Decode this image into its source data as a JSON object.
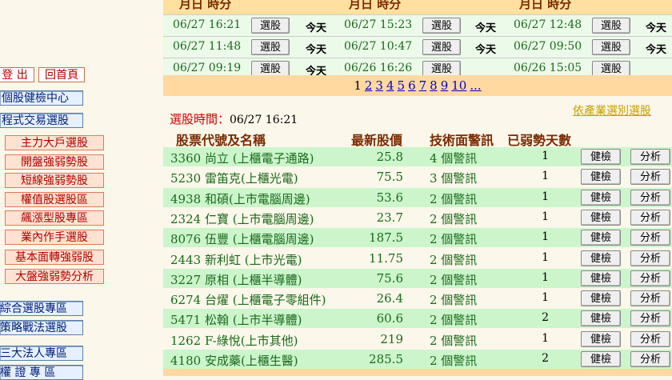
{
  "sidebar": {
    "logout": "登 出",
    "home": "回首頁",
    "items": [
      {
        "label": "個股健檢中心",
        "style": "blue"
      },
      {
        "label": "程式交易選股",
        "style": "blue"
      },
      {
        "label": "主力大戶選股",
        "style": "red"
      },
      {
        "label": "開盤強弱勢股",
        "style": "red"
      },
      {
        "label": "短線強弱勢股",
        "style": "red"
      },
      {
        "label": "權值股選股區",
        "style": "red"
      },
      {
        "label": "飆漲型股專區",
        "style": "red"
      },
      {
        "label": "業內作手選股",
        "style": "red"
      },
      {
        "label": "基本面轉強弱股",
        "style": "red"
      },
      {
        "label": "大盤強弱勢分析",
        "style": "red"
      },
      {
        "label": "綜合選股專區",
        "style": "blue"
      },
      {
        "label": "策略戰法選股",
        "style": "blue"
      },
      {
        "label": "三大法人專區",
        "style": "blue"
      },
      {
        "label": "權 證 專 區",
        "style": "blue"
      }
    ]
  },
  "history": {
    "header": [
      "月日 時分",
      "月日 時分",
      "月日 時分"
    ],
    "select_label": "選股",
    "today_label": "今天",
    "rows": [
      [
        "06/27 16:21",
        "06/27 15:23",
        "06/27 12:48"
      ],
      [
        "06/27 11:48",
        "06/27 10:47",
        "06/27 09:50"
      ],
      [
        "06/27 09:19",
        "06/26 16:26",
        "06/26 15:05"
      ]
    ]
  },
  "pager": {
    "current": "1",
    "pages": [
      "2",
      "3",
      "4",
      "5",
      "6",
      "7",
      "8",
      "9",
      "10",
      "..."
    ]
  },
  "results": {
    "time_label": "選股時間：",
    "time_value": "06/27 16:21",
    "industry_link": "依產業選別選股",
    "columns": {
      "name": "股票代號及名稱",
      "price": "最新股價",
      "tech": "技術面警訊",
      "days": "已弱勢天數"
    },
    "check_label": "健檢",
    "analyze_label": "分析",
    "rows": [
      {
        "name": "3360 尚立 (上櫃電子通路)",
        "price": "25.8",
        "tech": "4 個警訊",
        "days": "1"
      },
      {
        "name": "5230 雷笛克(上櫃光電)",
        "price": "75.5",
        "tech": "3 個警訊",
        "days": "1"
      },
      {
        "name": "4938 和碩(上市電腦周邊)",
        "price": "53.6",
        "tech": "2 個警訊",
        "days": "1"
      },
      {
        "name": "2324 仁寶 (上市電腦周邊)",
        "price": "23.7",
        "tech": "2 個警訊",
        "days": "1"
      },
      {
        "name": "8076 伍豐 (上櫃電腦周邊)",
        "price": "187.5",
        "tech": "2 個警訊",
        "days": "1"
      },
      {
        "name": "2443 新利虹 (上市光電)",
        "price": "11.75",
        "tech": "2 個警訊",
        "days": "1"
      },
      {
        "name": "3227 原相 (上櫃半導體)",
        "price": "75.6",
        "tech": "2 個警訊",
        "days": "1"
      },
      {
        "name": "6274 台燿 (上櫃電子零組件)",
        "price": "26.4",
        "tech": "2 個警訊",
        "days": "1"
      },
      {
        "name": "5471 松翰 (上市半導體)",
        "price": "60.6",
        "tech": "2 個警訊",
        "days": "2"
      },
      {
        "name": "1262 F-綠悅(上市其他)",
        "price": "219",
        "tech": "2 個警訊",
        "days": "1"
      },
      {
        "name": "4180 安成藥(上櫃生醫)",
        "price": "285.5",
        "tech": "2 個警訊",
        "days": "2"
      }
    ]
  },
  "footer_fragment": "1"
}
